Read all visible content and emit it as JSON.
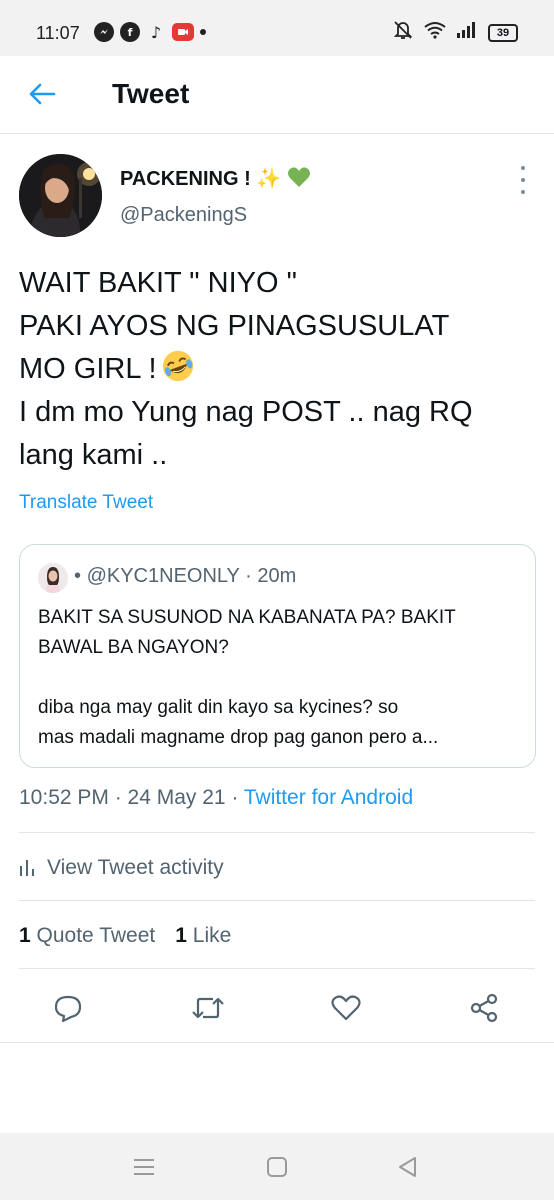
{
  "status_bar": {
    "time": "11:07",
    "battery": "39",
    "app_icons": [
      "messenger-icon",
      "facebook-icon",
      "tiktok-icon",
      "screen-recorder-icon"
    ]
  },
  "header": {
    "title": "Tweet"
  },
  "tweet": {
    "author_name": "PACKENING !",
    "author_emojis": [
      "sparkles",
      "green-heart"
    ],
    "author_handle": "@PackeningS",
    "text_lines": [
      "WAIT BAKIT \" NIYO \"",
      "PAKI AYOS NG PINAGSUSULAT",
      "MO GIRL !",
      "I dm mo Yung nag POST .. nag RQ",
      "lang kami .."
    ],
    "translate_label": "Translate Tweet",
    "time": "10:52 PM · 24 May 21 · ",
    "source": "Twitter for Android"
  },
  "quote": {
    "handle": "@KYC1NEONLY",
    "separator": "·",
    "age": "20m",
    "lines": [
      "BAKIT SA SUSUNOD NA KABANATA PA? BAKIT",
      "BAWAL BA NGAYON?",
      "diba nga may galit din kayo sa kycines? so",
      "mas madali magname drop pag ganon pero a..."
    ]
  },
  "activity": {
    "label": "View Tweet activity"
  },
  "stats": {
    "quote_count": "1",
    "quote_label": "Quote Tweet",
    "like_count": "1",
    "like_label": "Like"
  },
  "colors": {
    "accent": "#1d9bf0",
    "text_primary": "#0f1419",
    "text_secondary": "#536471",
    "border": "#cfd9de"
  },
  "actions": [
    "reply-icon",
    "retweet-icon",
    "like-icon",
    "share-icon"
  ],
  "nav": [
    "menu-icon",
    "home-square-icon",
    "back-triangle-icon"
  ]
}
